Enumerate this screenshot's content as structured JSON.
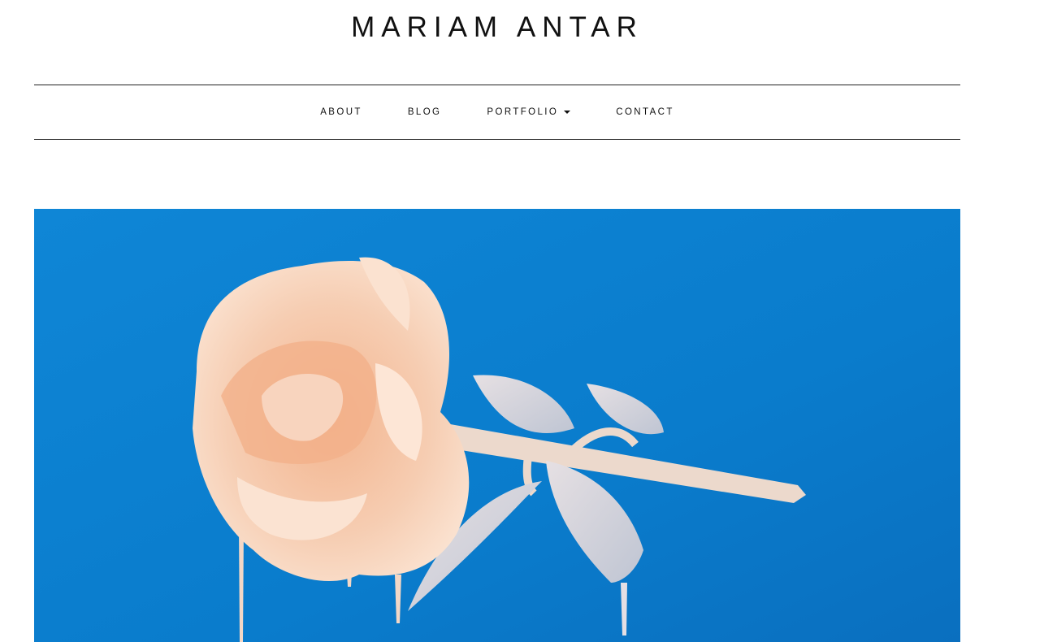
{
  "site": {
    "title": "MARIAM ANTAR"
  },
  "nav": {
    "items": [
      {
        "label": "ABOUT"
      },
      {
        "label": "BLOG"
      },
      {
        "label": "PORTFOLIO",
        "has_dropdown": true
      },
      {
        "label": "CONTACT"
      }
    ]
  },
  "hero": {
    "image": "rose-dripping-paint-photo",
    "background_color": "#0a7ed0",
    "subject_color": "#f6cdb2"
  }
}
